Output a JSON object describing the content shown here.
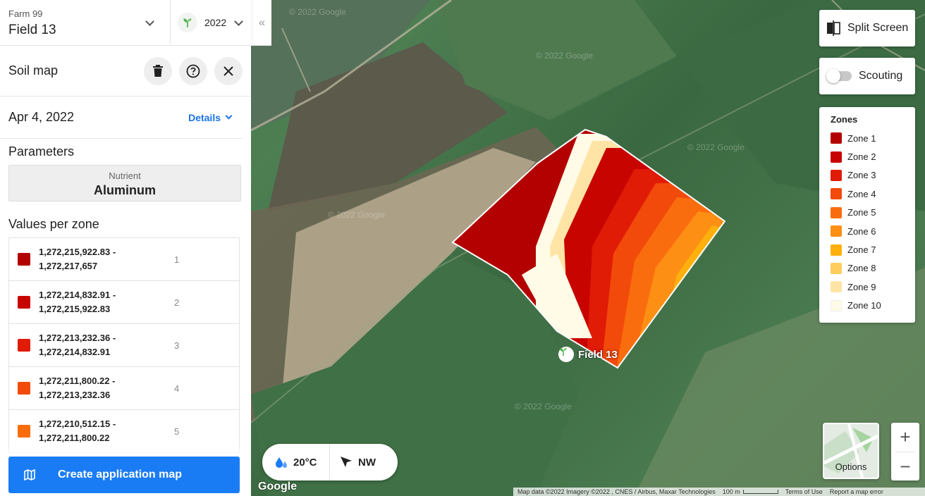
{
  "header": {
    "farm": "Farm 99",
    "field": "Field 13",
    "season": "2022",
    "collapse_icon": "double-chevron-left-icon"
  },
  "panel": {
    "title": "Soil map",
    "date": "Apr 4, 2022",
    "details_label": "Details",
    "parameters_title": "Parameters",
    "parameter": {
      "label": "Nutrient",
      "value": "Aluminum"
    },
    "values_title": "Values per zone",
    "zones": [
      {
        "range_low": "1,272,215,922.83 -",
        "range_high": "1,272,217,657",
        "index": "1",
        "color": "#b30000"
      },
      {
        "range_low": "1,272,214,832.91 -",
        "range_high": "1,272,215,922.83",
        "index": "2",
        "color": "#c80400"
      },
      {
        "range_low": "1,272,213,232.36 -",
        "range_high": "1,272,214,832.91",
        "index": "3",
        "color": "#e01b06"
      },
      {
        "range_low": "1,272,211,800.22 -",
        "range_high": "1,272,213,232.36",
        "index": "4",
        "color": "#f24a0a"
      },
      {
        "range_low": "1,272,210,512.15 -",
        "range_high": "1,272,211,800.22",
        "index": "5",
        "color": "#fa6d0e"
      }
    ],
    "create_button": "Create application map"
  },
  "controls": {
    "split_screen": "Split Screen",
    "scouting": "Scouting",
    "options": "Options"
  },
  "legend": {
    "title": "Zones",
    "items": [
      {
        "label": "Zone 1",
        "color": "#b30000"
      },
      {
        "label": "Zone 2",
        "color": "#c80400"
      },
      {
        "label": "Zone 3",
        "color": "#e01b06"
      },
      {
        "label": "Zone 4",
        "color": "#f24a0a"
      },
      {
        "label": "Zone 5",
        "color": "#fa6d0e"
      },
      {
        "label": "Zone 6",
        "color": "#fd8f14"
      },
      {
        "label": "Zone 7",
        "color": "#ffb00c"
      },
      {
        "label": "Zone 8",
        "color": "#ffcd5c"
      },
      {
        "label": "Zone 9",
        "color": "#ffe4a6"
      },
      {
        "label": "Zone 10",
        "color": "#fffbe6"
      }
    ]
  },
  "weather": {
    "temperature": "20°C",
    "wind": "NW"
  },
  "map": {
    "field_label": "Field 13",
    "watermark": "© 2022 Google",
    "google": "Google",
    "attribution": {
      "data": "Map data ©2022 Imagery ©2022 , CNES / Airbus, Maxar Technologies",
      "scale": "100 m",
      "terms": "Terms of Use",
      "report": "Report a map error"
    }
  }
}
